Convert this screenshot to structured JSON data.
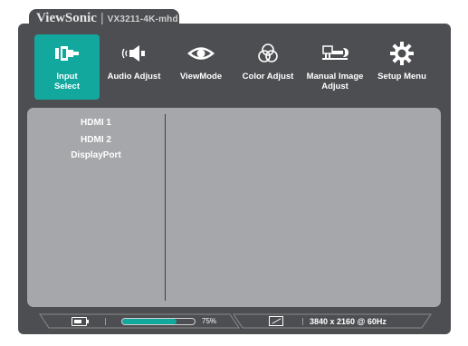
{
  "header": {
    "brand": "ViewSonic",
    "separator": "|",
    "model": "VX3211-4K-mhd"
  },
  "menu": [
    {
      "label": "Input\nSelect",
      "icon": "input-select-icon",
      "active": true
    },
    {
      "label": "Audio Adjust",
      "icon": "speaker-icon",
      "active": false
    },
    {
      "label": "ViewMode",
      "icon": "eye-icon",
      "active": false
    },
    {
      "label": "Color Adjust",
      "icon": "color-circles-icon",
      "active": false
    },
    {
      "label": "Manual Image\nAdjust",
      "icon": "wrench-icon",
      "active": false
    },
    {
      "label": "Setup Menu",
      "icon": "gear-icon",
      "active": false
    }
  ],
  "inputs": [
    "HDMI 1",
    "HDMI 2",
    "DisplayPort"
  ],
  "status": {
    "progress_label": "75%",
    "progress_value": 0.75,
    "resolution": "3840 x 2160 @ 60Hz"
  },
  "colors": {
    "frame": "#4d4e52",
    "accent": "#13a89e",
    "panel": "#a6a7aa"
  }
}
